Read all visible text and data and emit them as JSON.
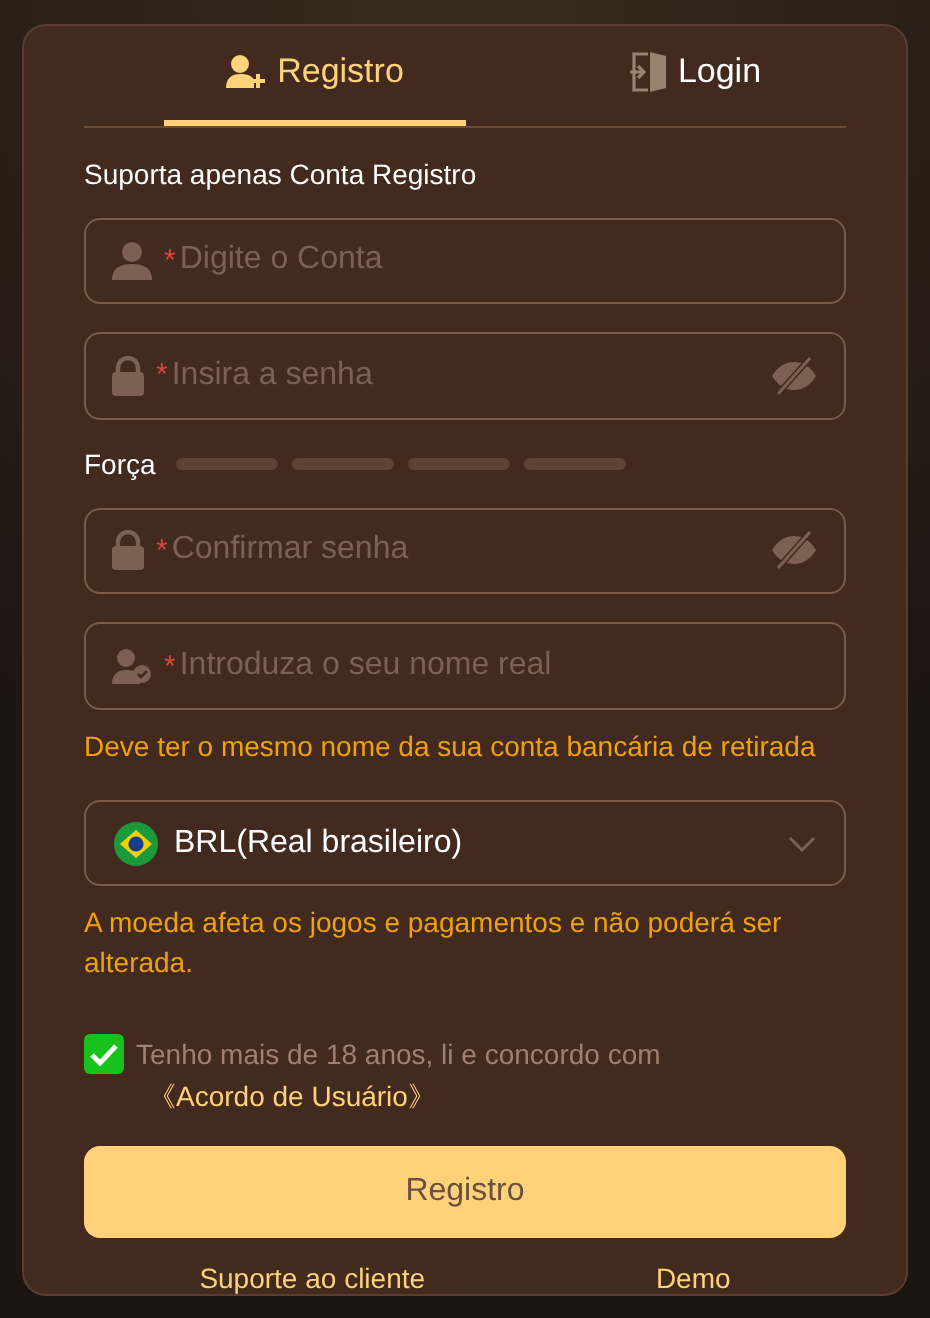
{
  "tabs": [
    {
      "label": "Registro",
      "kind": "register",
      "selected": true
    },
    {
      "label": "Login",
      "kind": "login",
      "selected": false
    }
  ],
  "notice": "Suporta apenas Conta Registro",
  "fields_top": [
    {
      "kind": "account",
      "required_mark": "*",
      "placeholder": "Digite o Conta"
    },
    {
      "kind": "password",
      "required_mark": "*",
      "placeholder": "Insira a senha"
    }
  ],
  "strength": {
    "label": "Força"
  },
  "fields_bottom": [
    {
      "kind": "password",
      "required_mark": "*",
      "placeholder": "Confirmar senha"
    },
    {
      "kind": "name",
      "required_mark": "*",
      "placeholder": "Introduza o seu nome real"
    }
  ],
  "name_hint": "Deve ter o mesmo nome da sua conta bancária de retirada",
  "currency": {
    "value": "BRL(Real brasileiro)"
  },
  "currency_note": "A moeda afeta os jogos e pagamentos e não poderá ser alterada.",
  "agreement": {
    "checked": true,
    "text": "Tenho mais de 18 anos, li e concordo com",
    "link": "《Acordo de Usuário》"
  },
  "submit": "Registro",
  "footer_links": [
    "Suporte ao cliente",
    "Demo"
  ]
}
